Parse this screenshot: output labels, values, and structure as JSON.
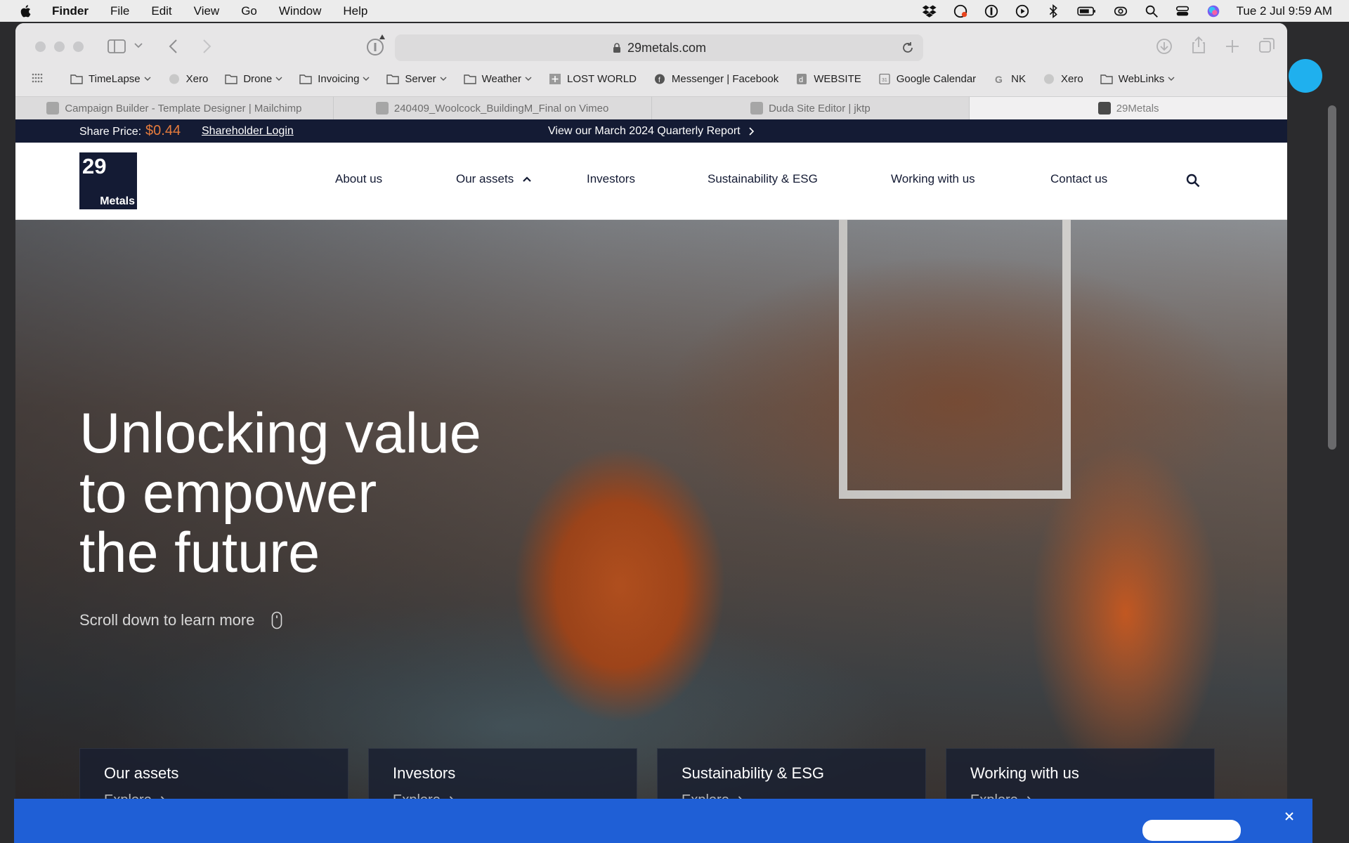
{
  "menubar": {
    "items": [
      "Finder",
      "File",
      "Edit",
      "View",
      "Go",
      "Window",
      "Help"
    ],
    "clock": "Tue 2 Jul  9:59 AM"
  },
  "browser": {
    "url": "29metals.com",
    "bookmarks": [
      {
        "label": "TimeLapse",
        "icon": "folder-icon",
        "menu": true
      },
      {
        "label": "Xero",
        "icon": "xero-icon",
        "menu": false
      },
      {
        "label": "Drone",
        "icon": "folder-icon",
        "menu": true
      },
      {
        "label": "Invoicing",
        "icon": "folder-icon",
        "menu": true
      },
      {
        "label": "Server",
        "icon": "folder-icon",
        "menu": true
      },
      {
        "label": "Weather",
        "icon": "folder-icon",
        "menu": true
      },
      {
        "label": "LOST WORLD",
        "icon": "plus-icon",
        "menu": false
      },
      {
        "label": "Messenger | Facebook",
        "icon": "facebook-icon",
        "menu": false
      },
      {
        "label": "WEBSITE",
        "icon": "duda-icon",
        "menu": false
      },
      {
        "label": "Google Calendar",
        "icon": "calendar-icon",
        "menu": false
      },
      {
        "label": "NK",
        "icon": "google-icon",
        "menu": false
      },
      {
        "label": "Xero",
        "icon": "xero-icon",
        "menu": false
      },
      {
        "label": "WebLinks",
        "icon": "folder-icon",
        "menu": true
      }
    ],
    "tabs": [
      {
        "label": "Campaign Builder - Template Designer | Mailchimp",
        "active": false
      },
      {
        "label": "240409_Woolcock_BuildingM_Final on Vimeo",
        "active": false
      },
      {
        "label": "Duda Site Editor | jktp",
        "active": false
      },
      {
        "label": "29Metals",
        "active": true
      }
    ]
  },
  "site": {
    "topbar": {
      "share_label": "Share Price:",
      "share_price": "$0.44",
      "login": "Shareholder Login",
      "report": "View our March 2024 Quarterly Report"
    },
    "logo": {
      "number": "29",
      "word": "Metals"
    },
    "nav": [
      "About us",
      "Our assets",
      "Investors",
      "Sustainability & ESG",
      "Working with us",
      "Contact us"
    ],
    "hero": {
      "title_lines": [
        "Unlocking value",
        "to empower",
        "the future"
      ],
      "scroll": "Scroll down to learn more"
    },
    "cards": [
      {
        "title": "Our assets",
        "cta": "Explore"
      },
      {
        "title": "Investors",
        "cta": "Explore"
      },
      {
        "title": "Sustainability & ESG",
        "cta": "Explore"
      },
      {
        "title": "Working with us",
        "cta": "Explore"
      }
    ]
  },
  "colors": {
    "navy": "#141b34",
    "price_orange": "#e57b3c",
    "cookie_blue": "#1f5fd6"
  }
}
